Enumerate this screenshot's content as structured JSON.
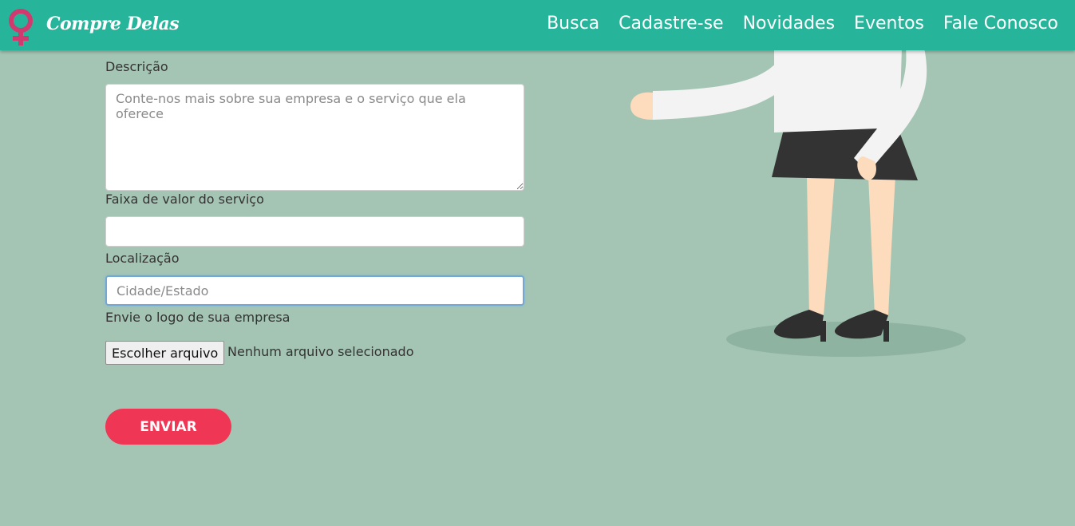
{
  "header": {
    "brand": "Compre Delas",
    "logo_icon": "female-symbol-icon",
    "nav": [
      {
        "label": "Busca"
      },
      {
        "label": "Cadastre-se"
      },
      {
        "label": "Novidades"
      },
      {
        "label": "Eventos"
      },
      {
        "label": "Fale Conosco"
      }
    ]
  },
  "form": {
    "description": {
      "label": "Descrição",
      "placeholder": "Conte-nos mais sobre sua empresa e o serviço que ela oferece",
      "value": ""
    },
    "price_range": {
      "label": "Faixa de valor do serviço",
      "placeholder": "",
      "value": ""
    },
    "location": {
      "label": "Localização",
      "placeholder": "Cidade/Estado",
      "value": ""
    },
    "logo_upload": {
      "label": "Envie o logo de sua empresa",
      "button_label": "Escolher arquivo",
      "status": "Nenhum arquivo selecionado"
    },
    "submit_label": "ENVIAR"
  },
  "colors": {
    "background": "#a4c5b4",
    "navbar": "#26b59b",
    "logo": "#d13a6e",
    "submit": "#ef3654"
  },
  "illustration": {
    "icon": "woman-illustration"
  }
}
